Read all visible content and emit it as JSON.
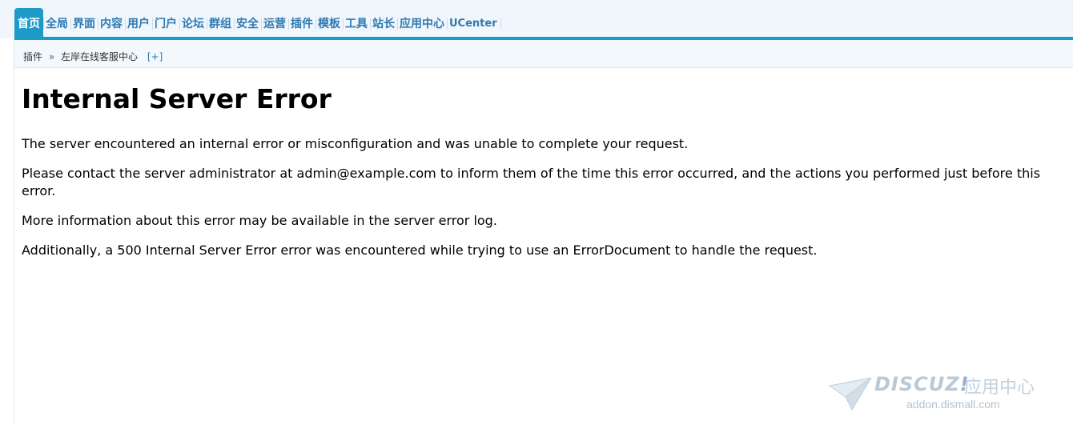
{
  "nav": {
    "tabs": [
      {
        "label": "首页",
        "active": true
      },
      {
        "label": "全局"
      },
      {
        "label": "界面"
      },
      {
        "label": "内容"
      },
      {
        "label": "用户"
      },
      {
        "label": "门户"
      },
      {
        "label": "论坛"
      },
      {
        "label": "群组"
      },
      {
        "label": "安全"
      },
      {
        "label": "运营"
      },
      {
        "label": "插件"
      },
      {
        "label": "模板"
      },
      {
        "label": "工具"
      },
      {
        "label": "站长"
      },
      {
        "label": "应用中心"
      },
      {
        "label": "UCenter"
      }
    ]
  },
  "breadcrumb": {
    "items": [
      "插件",
      "左岸在线客服中心"
    ],
    "separator": "»",
    "add_label": "[+]"
  },
  "error": {
    "title": "Internal Server Error",
    "paragraphs": [
      "The server encountered an internal error or misconfiguration and was unable to complete your request.",
      "Please contact the server administrator at admin@example.com to inform them of the time this error occurred, and the actions you performed just before this error.",
      "More information about this error may be available in the server error log.",
      "Additionally, a 500 Internal Server Error error was encountered while trying to use an ErrorDocument to handle the request."
    ]
  },
  "watermark": {
    "brand": "DISCUZ",
    "brand_mark": "!",
    "subtitle": "应用中心",
    "domain": "addon.dismall.com"
  },
  "colors": {
    "accent": "#1d9ac7",
    "tab_text": "#2e7ab2",
    "nav_bg": "#f0f6fc"
  }
}
